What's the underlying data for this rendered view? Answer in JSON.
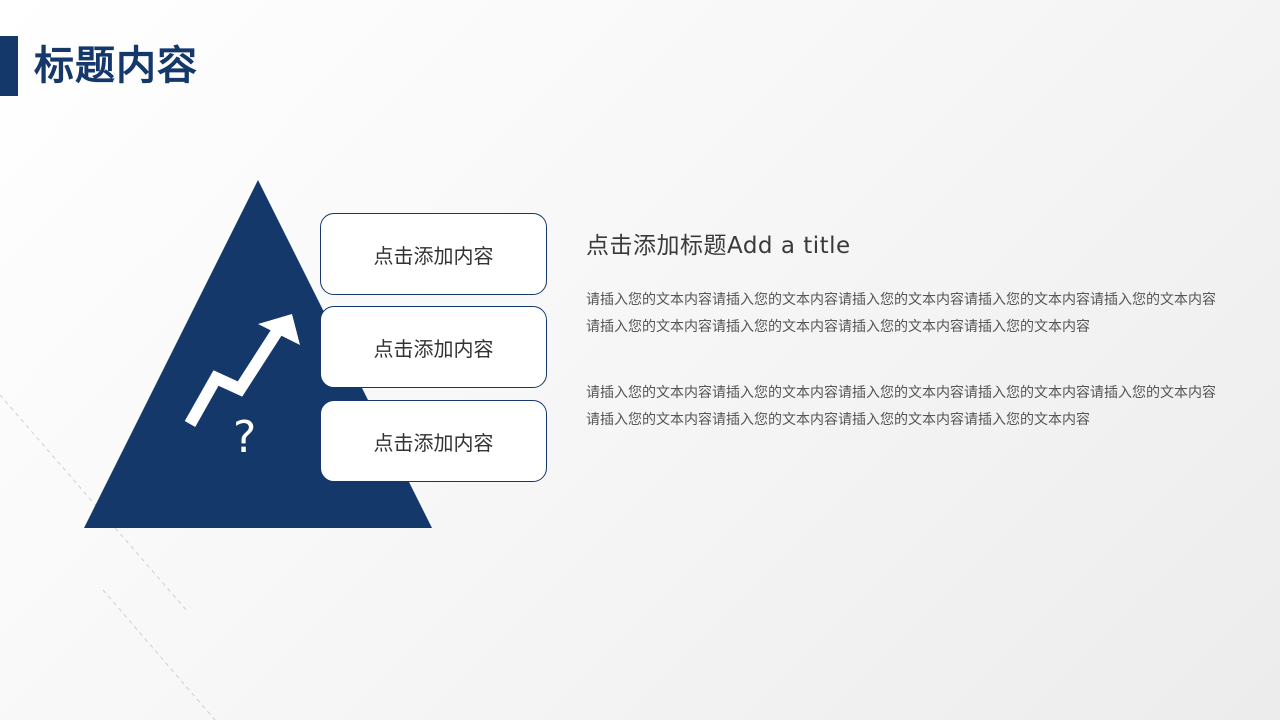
{
  "slide": {
    "title": "标题内容",
    "accent_color": "#15386b"
  },
  "graphic": {
    "arrow_icon": "trend-up-arrow-icon",
    "question_mark": "?"
  },
  "items": [
    {
      "label": "点击添加内容"
    },
    {
      "label": "点击添加内容"
    },
    {
      "label": "点击添加内容"
    }
  ],
  "content": {
    "heading": "点击添加标题Add a title",
    "paragraphs": [
      "请插入您的文本内容请插入您的文本内容请插入您的文本内容请插入您的文本内容请插入您的文本内容请插入您的文本内容请插入您的文本内容请插入您的文本内容请插入您的文本内容",
      "请插入您的文本内容请插入您的文本内容请插入您的文本内容请插入您的文本内容请插入您的文本内容请插入您的文本内容请插入您的文本内容请插入您的文本内容请插入您的文本内容"
    ]
  }
}
